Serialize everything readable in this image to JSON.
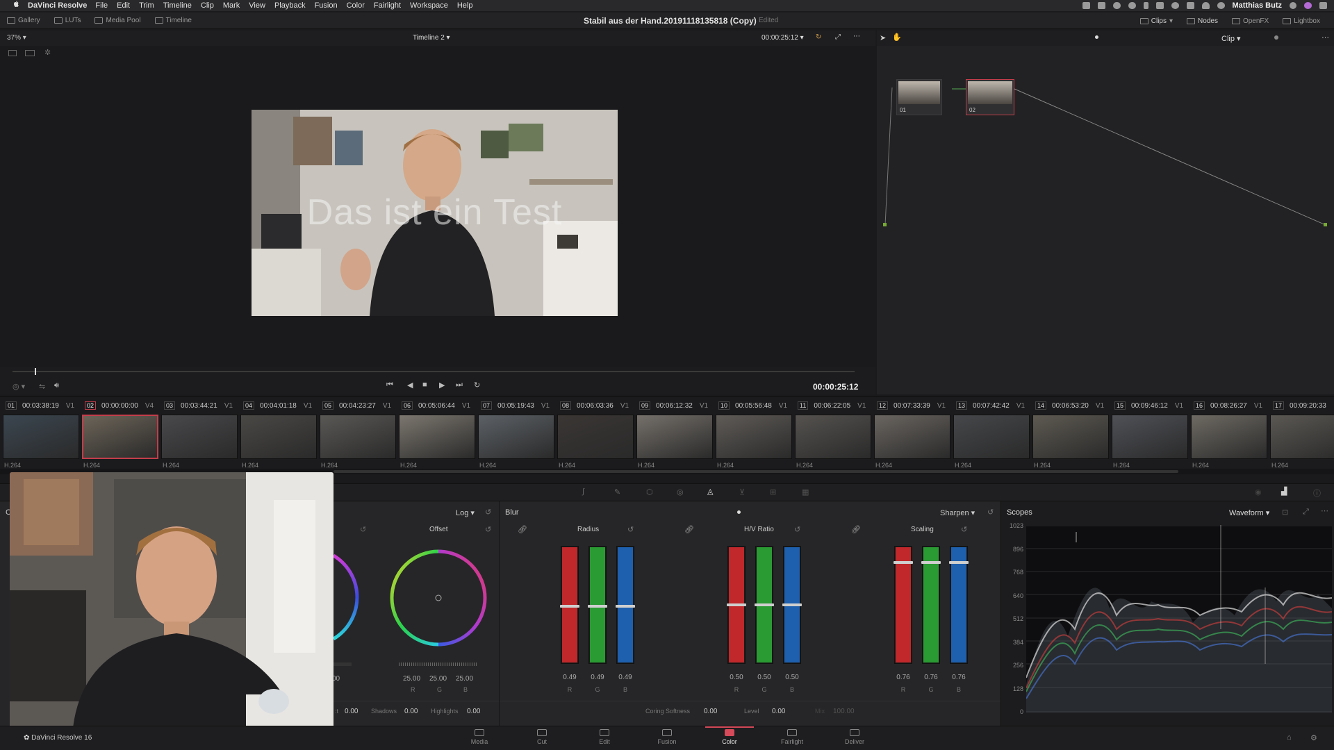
{
  "menubar": {
    "app_name": "DaVinci Resolve",
    "items": [
      "File",
      "Edit",
      "Trim",
      "Timeline",
      "Clip",
      "Mark",
      "View",
      "Playback",
      "Fusion",
      "Color",
      "Fairlight",
      "Workspace",
      "Help"
    ],
    "user": "Matthias Butz"
  },
  "toolbar": {
    "left": [
      "Gallery",
      "LUTs",
      "Media Pool",
      "Timeline"
    ],
    "project_title": "Stabil aus der Hand.20191118135818 (Copy)",
    "edited": "Edited",
    "right": [
      "Clips",
      "Nodes",
      "OpenFX",
      "Lightbox"
    ]
  },
  "viewer": {
    "zoom": "37%",
    "timeline_name": "Timeline 2",
    "timecode_top": "00:00:25:12",
    "overlay_text": "Das ist ein Test",
    "timecode": "00:00:25:12",
    "clip_mode": "Clip"
  },
  "nodes": [
    {
      "label": "01"
    },
    {
      "label": "02"
    }
  ],
  "clips": [
    {
      "num": "01",
      "tc": "00:03:38:19",
      "track": "V1",
      "fmt": "H.264",
      "tone": "#3b4650"
    },
    {
      "num": "02",
      "tc": "00:00:00:00",
      "track": "V4",
      "fmt": "H.264",
      "tone": "#6c6458",
      "selected": true
    },
    {
      "num": "03",
      "tc": "00:03:44:21",
      "track": "V1",
      "fmt": "H.264",
      "tone": "#49494c"
    },
    {
      "num": "04",
      "tc": "00:04:01:18",
      "track": "V1",
      "fmt": "H.264",
      "tone": "#4a4845"
    },
    {
      "num": "05",
      "tc": "00:04:23:27",
      "track": "V1",
      "fmt": "H.264",
      "tone": "#5a5855"
    },
    {
      "num": "06",
      "tc": "00:05:06:44",
      "track": "V1",
      "fmt": "H.264",
      "tone": "#7c776f"
    },
    {
      "num": "07",
      "tc": "00:05:19:43",
      "track": "V1",
      "fmt": "H.264",
      "tone": "#5c6166"
    },
    {
      "num": "08",
      "tc": "00:06:03:36",
      "track": "V1",
      "fmt": "H.264",
      "tone": "#3a3634"
    },
    {
      "num": "09",
      "tc": "00:06:12:32",
      "track": "V1",
      "fmt": "H.264",
      "tone": "#75706a"
    },
    {
      "num": "10",
      "tc": "00:05:56:48",
      "track": "V1",
      "fmt": "H.264",
      "tone": "#5f5b57"
    },
    {
      "num": "11",
      "tc": "00:06:22:05",
      "track": "V1",
      "fmt": "H.264",
      "tone": "#55524f"
    },
    {
      "num": "12",
      "tc": "00:07:33:39",
      "track": "V1",
      "fmt": "H.264",
      "tone": "#6a6560"
    },
    {
      "num": "13",
      "tc": "00:07:42:42",
      "track": "V1",
      "fmt": "H.264",
      "tone": "#45474a"
    },
    {
      "num": "14",
      "tc": "00:06:53:20",
      "track": "V1",
      "fmt": "H.264",
      "tone": "#5e5a52"
    },
    {
      "num": "15",
      "tc": "00:09:46:12",
      "track": "V1",
      "fmt": "H.264",
      "tone": "#4f5157"
    },
    {
      "num": "16",
      "tc": "00:08:26:27",
      "track": "V1",
      "fmt": "H.264",
      "tone": "#6e6a63"
    },
    {
      "num": "17",
      "tc": "00:09:20:33",
      "track": "",
      "fmt": "H.264",
      "tone": "#5b5853"
    }
  ],
  "color_panel": {
    "left_header": "Co",
    "log_label": "Log",
    "offset_label": "Offset",
    "offset_values": [
      "25.00",
      "25.00",
      "25.00"
    ],
    "rgb_labels": [
      "R",
      "G",
      "B"
    ],
    "partial_value": "00",
    "bottom_partial": ":t",
    "bottom_first": "0.00",
    "shadows_label": "Shadows",
    "shadows": "0.00",
    "highlights_label": "Highlights",
    "highlights": "0.00"
  },
  "blur_panel": {
    "title": "Blur",
    "mode": "Sharpen",
    "groups": [
      {
        "label": "Radius",
        "values": [
          "0.49",
          "0.49",
          "0.49"
        ],
        "level": 0.49
      },
      {
        "label": "H/V Ratio",
        "values": [
          "0.50",
          "0.50",
          "0.50"
        ],
        "level": 0.5
      },
      {
        "label": "Scaling",
        "values": [
          "0.76",
          "0.76",
          "0.76"
        ],
        "level": 0.76
      }
    ],
    "coring_label": "Coring Softness",
    "coring": "0.00",
    "level_label": "Level",
    "level": "0.00",
    "mix_label": "Mix",
    "mix": "100.00"
  },
  "scopes": {
    "title": "Scopes",
    "mode": "Waveform",
    "ticks": [
      "1023",
      "896",
      "768",
      "640",
      "512",
      "384",
      "256",
      "128",
      "0"
    ]
  },
  "pages": [
    "Media",
    "Cut",
    "Edit",
    "Fusion",
    "Color",
    "Fairlight",
    "Deliver"
  ],
  "active_page": "Color",
  "footer_app": "DaVinci Resolve 16",
  "colors": {
    "accent": "#d64a5a",
    "red": "#c0282b",
    "green": "#2a9a33",
    "blue": "#1e5fae"
  }
}
